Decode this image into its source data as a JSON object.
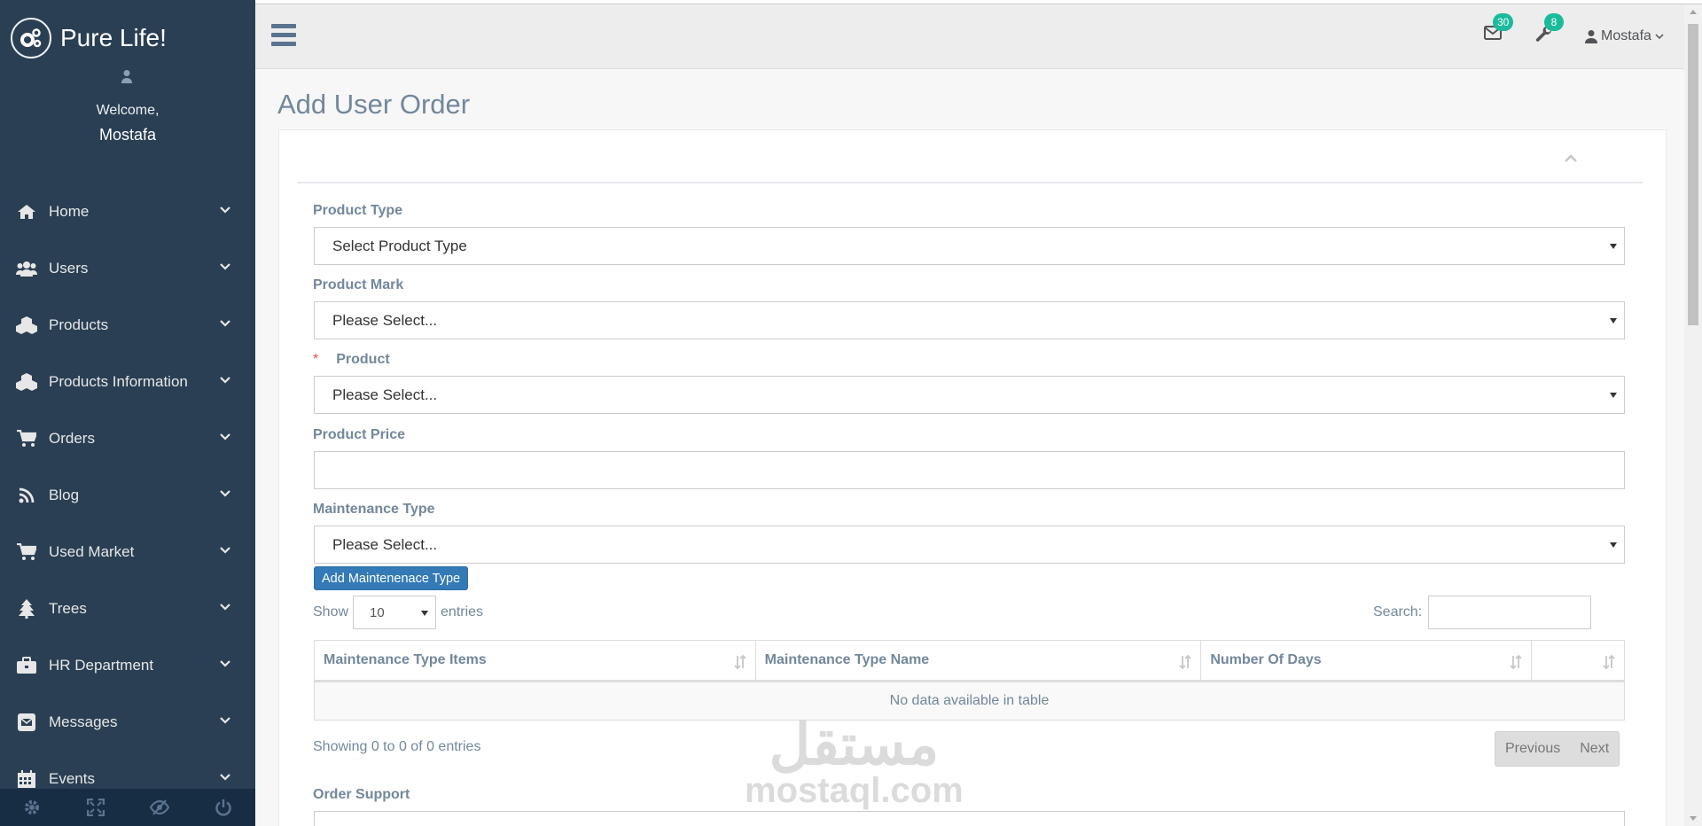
{
  "sidebar": {
    "brand": "Pure Life!",
    "welcome": "Welcome,",
    "username": "Mostafa",
    "items": [
      {
        "label": "Home",
        "icon": "home-icon"
      },
      {
        "label": "Users",
        "icon": "users-icon"
      },
      {
        "label": "Products",
        "icon": "cubes-icon"
      },
      {
        "label": "Products Information",
        "icon": "cubes-icon"
      },
      {
        "label": "Orders",
        "icon": "shopping-cart-icon"
      },
      {
        "label": "Blog",
        "icon": "rss-icon"
      },
      {
        "label": "Used Market",
        "icon": "shopping-cart-icon"
      },
      {
        "label": "Trees",
        "icon": "tree-icon"
      },
      {
        "label": "HR Department",
        "icon": "briefcase-icon"
      },
      {
        "label": "Messages",
        "icon": "envelope-square-icon"
      },
      {
        "label": "Events",
        "icon": "calendar-icon"
      }
    ],
    "footer": [
      "settings-icon",
      "fullscreen-icon",
      "eye-slash-icon",
      "power-off-icon"
    ]
  },
  "topnav": {
    "mail_count": "30",
    "alerts_count": "8",
    "user": "Mostafa"
  },
  "page": {
    "title": "Add User Order"
  },
  "form": {
    "product_type": {
      "label": "Product Type",
      "value": "Select Product Type"
    },
    "product_mark": {
      "label": "Product Mark",
      "value": "Please Select..."
    },
    "product": {
      "required_mark": "*",
      "label": "Product",
      "value": "Please Select..."
    },
    "product_price": {
      "label": "Product Price",
      "value": ""
    },
    "maintenance_type": {
      "label": "Maintenance Type",
      "value": "Please Select..."
    },
    "add_button": "Add Maintenenace Type",
    "order_support": {
      "label": "Order Support"
    }
  },
  "datatable": {
    "show_label": "Show",
    "length_value": "10",
    "entries_label": "entries",
    "search_label": "Search:",
    "columns": [
      "Maintenance Type Items",
      "Maintenance Type Name",
      "Number Of Days",
      ""
    ],
    "empty_message": "No data available in table",
    "info": "Showing 0 to 0 of 0 entries",
    "prev": "Previous",
    "next": "Next"
  },
  "watermark": {
    "arabic": "مستقل",
    "latin": "mostaql.com"
  },
  "colors": {
    "sidebar_bg": "#2A3F54",
    "accent_badge": "#1ABB9C",
    "primary_button": "#337AB7",
    "text": "#73879C"
  }
}
